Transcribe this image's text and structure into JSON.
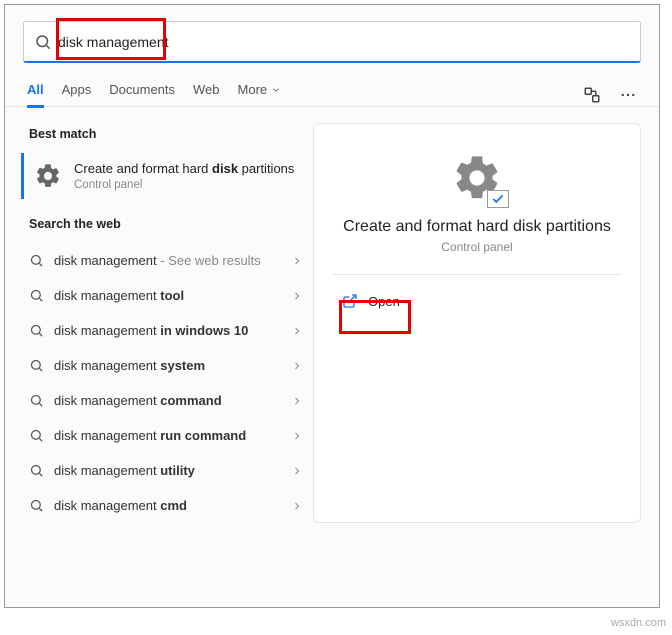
{
  "search": {
    "value": "disk management"
  },
  "tabs": {
    "all": "All",
    "apps": "Apps",
    "documents": "Documents",
    "web": "Web",
    "more": "More"
  },
  "bestMatch": {
    "label": "Best match",
    "title_pre": "Create and format hard ",
    "title_bold": "disk",
    "title_post": " partitions",
    "subtitle": "Control panel"
  },
  "webSection": {
    "label": "Search the web"
  },
  "webItems": [
    {
      "pre": "disk management",
      "bold": "",
      "post": "",
      "hint": " - See web results"
    },
    {
      "pre": "disk management ",
      "bold": "tool",
      "post": "",
      "hint": ""
    },
    {
      "pre": "disk management ",
      "bold": "in windows 10",
      "post": "",
      "hint": ""
    },
    {
      "pre": "disk management ",
      "bold": "system",
      "post": "",
      "hint": ""
    },
    {
      "pre": "disk management ",
      "bold": "command",
      "post": "",
      "hint": ""
    },
    {
      "pre": "disk management ",
      "bold": "run command",
      "post": "",
      "hint": ""
    },
    {
      "pre": "disk management ",
      "bold": "utility",
      "post": "",
      "hint": ""
    },
    {
      "pre": "disk management ",
      "bold": "cmd",
      "post": "",
      "hint": ""
    }
  ],
  "preview": {
    "title": "Create and format hard disk partitions",
    "subtitle": "Control panel",
    "open": "Open"
  },
  "watermark": "wsxdn.com"
}
